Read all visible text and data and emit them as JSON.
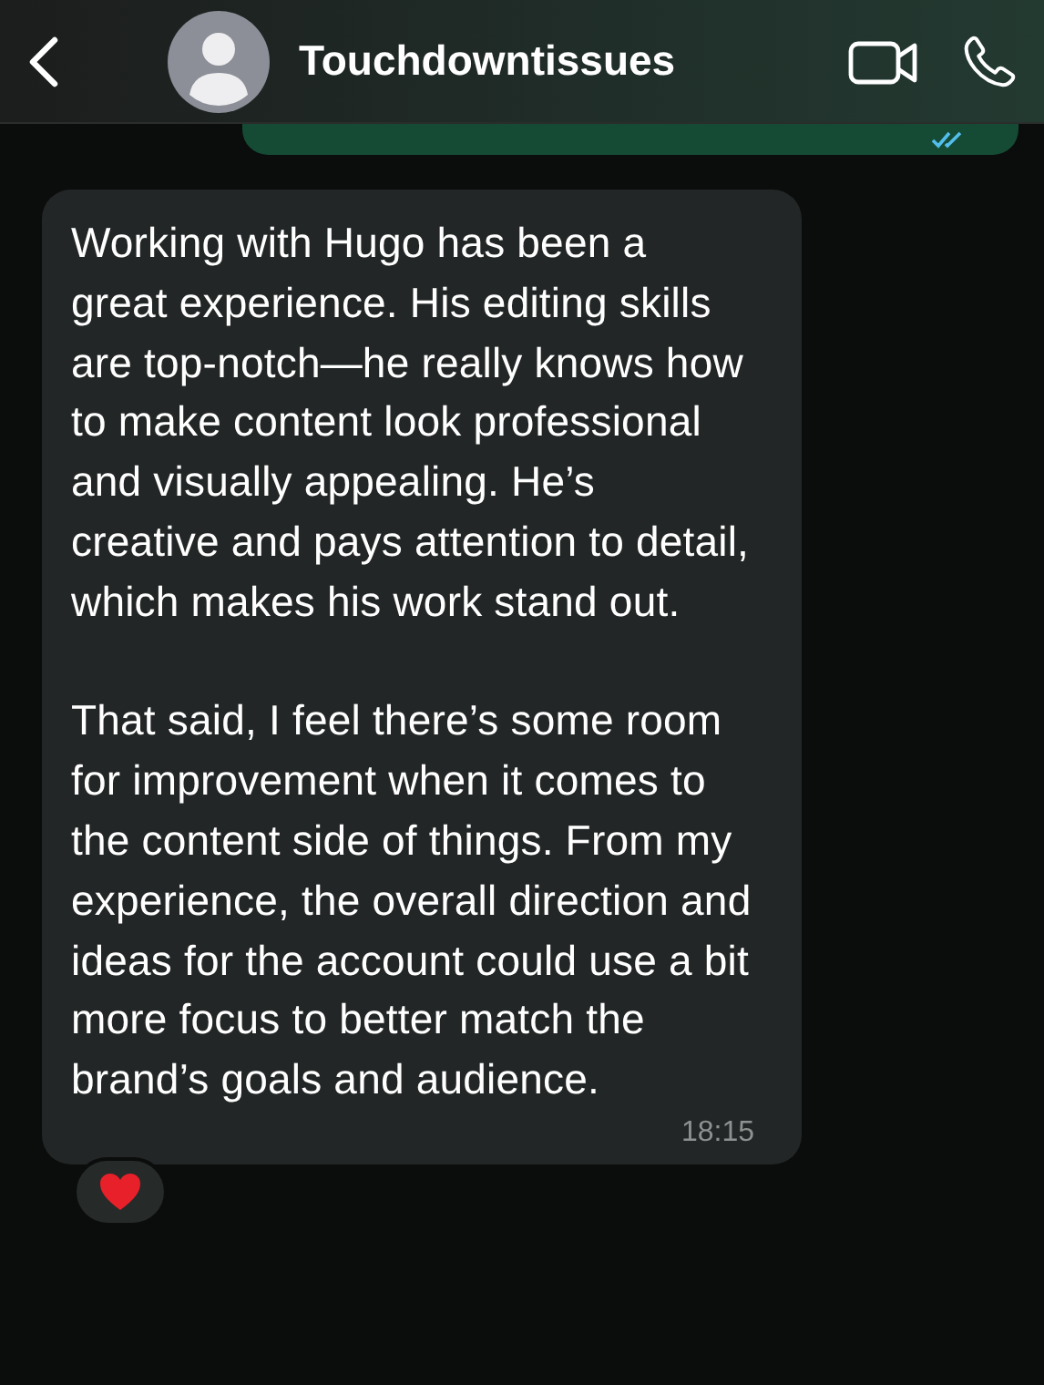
{
  "header": {
    "contact_name": "Touchdowntissues"
  },
  "messages": [
    {
      "kind": "sent",
      "read": true
    },
    {
      "kind": "received",
      "paragraphs": [
        "Working with Hugo has been a great experience. His editing skills are top-notch—he really knows how to make content look professional and visually appealing. He’s creative and pays attention to detail, which makes his work stand out.",
        "That said, I feel there’s some room for improvement when it comes to the content side of things. From my experience, the overall direction and ideas for the account could use a bit more focus to better match the brand’s goals and audience."
      ],
      "time": "18:15",
      "has_reaction": true
    }
  ]
}
